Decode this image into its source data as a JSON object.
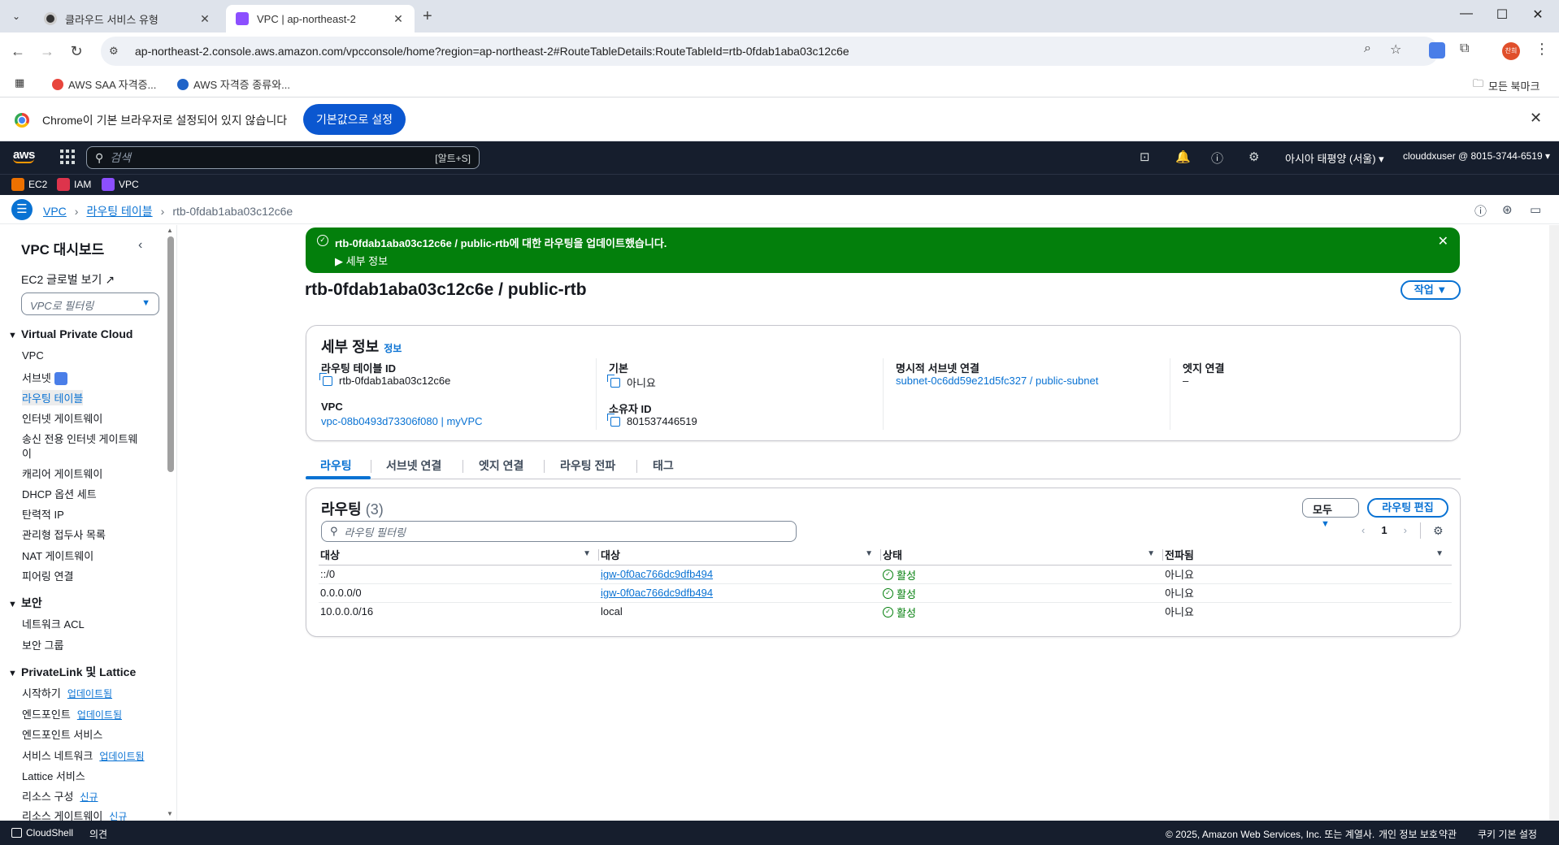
{
  "browser": {
    "tabs": [
      {
        "title": "클라우드 서비스 유형",
        "active": false
      },
      {
        "title": "VPC | ap-northeast-2",
        "active": true
      }
    ],
    "url": "ap-northeast-2.console.aws.amazon.com/vpcconsole/home?region=ap-northeast-2#RouteTableDetails:RouteTableId=rtb-0fdab1aba03c12c6e",
    "profile_label": "찬희",
    "bookmarks": [
      {
        "label": "AWS SAA 자격증..."
      },
      {
        "label": "AWS 자격증 종류와..."
      }
    ],
    "all_bookmarks": "모든 북마크",
    "infobar": {
      "message": "Chrome이 기본 브라우저로 설정되어 있지 않습니다",
      "button": "기본값으로 설정"
    }
  },
  "aws": {
    "logo": "aws",
    "search_placeholder": "검색",
    "search_shortcut": "[알트+S]",
    "region": "아시아 태평양 (서울) ▾",
    "account": "clouddxuser @ 8015-3744-6519 ▾",
    "services": [
      {
        "label": "EC2",
        "color": "#ed7100"
      },
      {
        "label": "IAM",
        "color": "#dd344c"
      },
      {
        "label": "VPC",
        "color": "#8c4fff"
      }
    ]
  },
  "breadcrumb": {
    "items": [
      "VPC",
      "라우팅 테이블"
    ],
    "current": "rtb-0fdab1aba03c12c6e"
  },
  "sidebar": {
    "title": "VPC 대시보드",
    "ec2_global": "EC2 글로벌 보기",
    "filter_placeholder": "VPC로 필터링",
    "sections": [
      {
        "title": "Virtual Private Cloud"
      },
      {
        "title": "보안"
      },
      {
        "title": "PrivateLink 및 Lattice"
      }
    ],
    "vpc_items": [
      "VPC",
      "서브넷",
      "라우팅 테이블",
      "인터넷 게이트웨이",
      "송신 전용 인터넷 게이트웨",
      "이",
      "캐리어 게이트웨이",
      "DHCP 옵션 세트",
      "탄력적 IP",
      "관리형 접두사 목록",
      "NAT 게이트웨이",
      "피어링 연결"
    ],
    "security_items": [
      "네트워크 ACL",
      "보안 그룹"
    ],
    "privatelink_items": [
      {
        "label": "시작하기",
        "badge": "업데이트됨"
      },
      {
        "label": "엔드포인트",
        "badge": "업데이트됨"
      },
      {
        "label": "엔드포인트 서비스",
        "badge": ""
      },
      {
        "label": "서비스 네트워크",
        "badge": "업데이트됨"
      },
      {
        "label": "Lattice 서비스",
        "badge": ""
      },
      {
        "label": "리소스 구성",
        "badge": "신규"
      },
      {
        "label": "리소스 게이트웨이",
        "badge": "신규"
      }
    ]
  },
  "flash": {
    "message": "rtb-0fdab1aba03c12c6e / public-rtb에 대한 라우팅을 업데이트했습니다.",
    "details": "▶ 세부 정보"
  },
  "page": {
    "title": "rtb-0fdab1aba03c12c6e / public-rtb",
    "action_button": "작업 ▼"
  },
  "details": {
    "header": "세부 정보",
    "info": "정보",
    "route_table_id_label": "라우팅 테이블 ID",
    "route_table_id": "rtb-0fdab1aba03c12c6e",
    "main_label": "기본",
    "main_value": "아니요",
    "explicit_subnet_label": "명시적 서브넷 연결",
    "explicit_subnet_value": "subnet-0c6dd59e21d5fc327 / public-subnet",
    "edge_label": "엣지 연결",
    "edge_value": "–",
    "vpc_label": "VPC",
    "vpc_value": "vpc-08b0493d73306f080 | myVPC",
    "owner_label": "소유자 ID",
    "owner_value": "801537446519"
  },
  "tabs": [
    "라우팅",
    "서브넷 연결",
    "엣지 연결",
    "라우팅 전파",
    "태그"
  ],
  "routes": {
    "title": "라우팅",
    "count": "(3)",
    "filter_button": "모두",
    "edit_button": "라우팅 편집",
    "filter_placeholder": "라우팅 필터링",
    "page": "1",
    "columns": [
      "대상",
      "대상",
      "상태",
      "전파됨"
    ],
    "rows": [
      {
        "destination": "::/0",
        "target": "igw-0f0ac766dc9dfb494",
        "target_link": true,
        "status": "활성",
        "propagated": "아니요"
      },
      {
        "destination": "0.0.0.0/0",
        "target": "igw-0f0ac766dc9dfb494",
        "target_link": true,
        "status": "활성",
        "propagated": "아니요"
      },
      {
        "destination": "10.0.0.0/16",
        "target": "local",
        "target_link": false,
        "status": "활성",
        "propagated": "아니요"
      }
    ]
  },
  "footer": {
    "cloudshell": "CloudShell",
    "feedback": "의견",
    "copyright": "© 2025, Amazon Web Services, Inc. 또는 계열사.",
    "privacy": "개인 정보 보호",
    "terms": "약관",
    "cookies": "쿠키 기본 설정"
  }
}
